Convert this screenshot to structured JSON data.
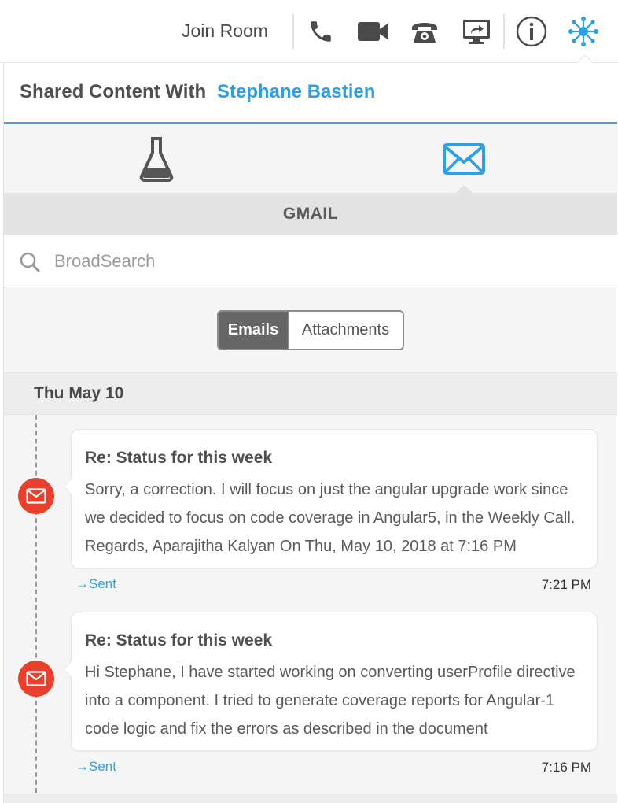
{
  "toolbar": {
    "join_room_label": "Join Room",
    "icons": [
      "phone-icon",
      "video-camera-icon",
      "telephone-icon",
      "screen-share-icon",
      "info-icon",
      "network-icon"
    ],
    "accent_color": "#2f9fe3"
  },
  "shared": {
    "label": "Shared Content With",
    "name": "Stephane Bastien"
  },
  "app_tabs": [
    {
      "icon": "flask-icon",
      "active": false
    },
    {
      "icon": "mail-icon",
      "active": true
    }
  ],
  "source": {
    "title": "GMAIL"
  },
  "search": {
    "placeholder": "BroadSearch",
    "value": ""
  },
  "filter": {
    "options": [
      "Emails",
      "Attachments"
    ],
    "selected": "Emails"
  },
  "date_group": "Thu May 10",
  "emails": [
    {
      "subject": "Re: Status for this week",
      "snippet": "Sorry, a correction. I will focus on just the angular upgrade work since we decided to focus on code coverage in Angular5, in the Weekly Call. Regards, Aparajitha Kalyan On Thu, May 10, 2018 at 7:16 PM",
      "direction": "→Sent",
      "time": "7:21 PM"
    },
    {
      "subject": "Re: Status for this week",
      "snippet": "Hi Stephane, I have started working on converting userProfile directive into a component. I tried to generate coverage reports for Angular-1 code logic and fix the errors as described in the document",
      "direction": "→Sent",
      "time": "7:16 PM"
    }
  ],
  "colors": {
    "gmail_red": "#e8402c",
    "segment_active": "#666666"
  }
}
